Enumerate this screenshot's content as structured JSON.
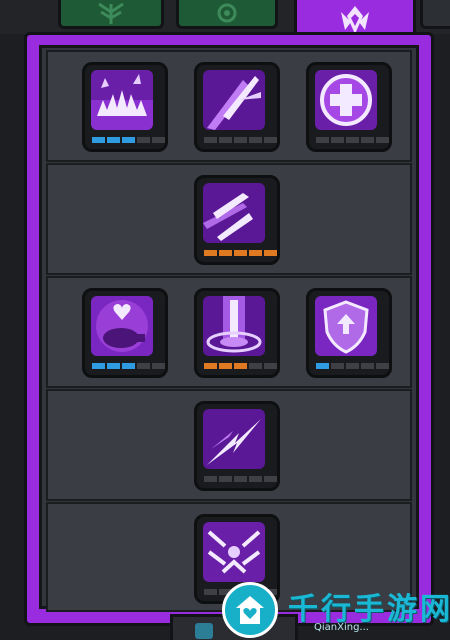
{
  "tabs": [
    {
      "id": "tab-1",
      "icon": "tree-icon",
      "active": false
    },
    {
      "id": "tab-2",
      "icon": "cog-icon",
      "active": false
    },
    {
      "id": "tab-3",
      "icon": "emblem-icon",
      "active": true
    }
  ],
  "colors": {
    "frame": "#9a2ce0",
    "panel": "#33363c",
    "pip_blue": "#2f9be0",
    "pip_orange": "#e07a22",
    "pip_empty": "#3e4046"
  },
  "tiers": [
    {
      "skills": [
        {
          "name": "burst-spikes-icon",
          "pips_total": 5,
          "pips_filled": 3,
          "pip_color": "blue"
        },
        {
          "name": "piercing-strike-icon",
          "pips_total": 5,
          "pips_filled": 0,
          "pip_color": "blue"
        },
        {
          "name": "healing-cross-icon",
          "pips_total": 5,
          "pips_filled": 0,
          "pip_color": "blue"
        }
      ]
    },
    {
      "skills": [
        {
          "name": "twin-blades-icon",
          "pips_total": 5,
          "pips_filled": 5,
          "pip_color": "orange"
        }
      ]
    },
    {
      "skills": [
        {
          "name": "pet-heart-icon",
          "pips_total": 5,
          "pips_filled": 3,
          "pip_color": "blue"
        },
        {
          "name": "sword-pillar-icon",
          "pips_total": 5,
          "pips_filled": 3,
          "pip_color": "orange"
        },
        {
          "name": "shield-upgrade-icon",
          "pips_total": 5,
          "pips_filled": 1,
          "pip_color": "blue"
        }
      ]
    },
    {
      "skills": [
        {
          "name": "lightning-dash-icon",
          "pips_total": 5,
          "pips_filled": 0,
          "pip_color": "blue"
        }
      ]
    },
    {
      "skills": [
        {
          "name": "sword-rain-icon",
          "pips_total": 5,
          "pips_filled": 0,
          "pip_color": "blue"
        }
      ]
    }
  ],
  "watermark": {
    "chinese": "千行手游网",
    "english": "QianXing..."
  }
}
